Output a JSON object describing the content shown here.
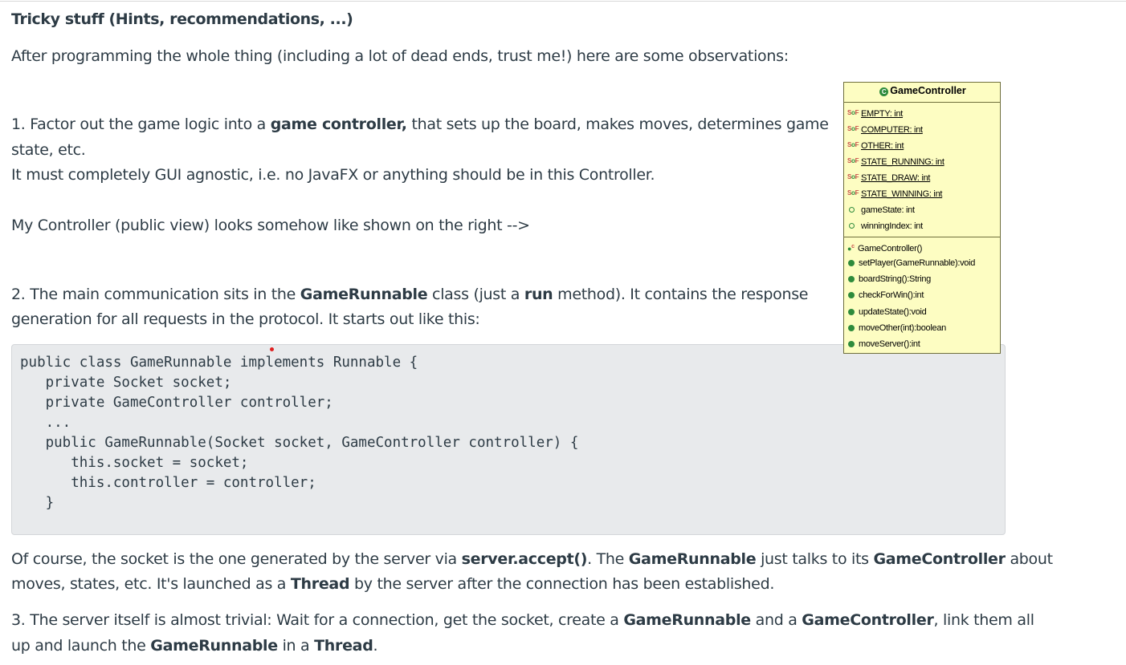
{
  "heading": "Tricky stuff (Hints, recommendations, ...)",
  "intro": "After programming the whole thing (including a lot of dead ends, trust me!) here are some observations:",
  "item1": {
    "a": "1. Factor out the game logic into a ",
    "b": "game controller,",
    "c": " that sets up the board, makes moves, determines game",
    "line2": "state, etc.",
    "line3": "It must completely GUI agnostic, i.e. no JavaFX or anything should be in this Controller.",
    "line4": "My Controller (public view) looks somehow like shown on the right -->"
  },
  "item2": {
    "a": "2. The main communication sits in the ",
    "b": "GameRunnable",
    "c": " class (just a ",
    "d": "run",
    "e": " method). It contains the response",
    "line2": "generation for all requests in the protocol.  It starts out like this:"
  },
  "code_lines": [
    "public class GameRunnable implements Runnable {",
    "   private Socket socket;",
    "   private GameController controller;",
    "   ...",
    "   public GameRunnable(Socket socket, GameController controller) {",
    "      this.socket = socket;",
    "      this.controller = controller;",
    "   }"
  ],
  "para_course": {
    "a": "Of course, the socket is the one generated by the server via ",
    "b": "server.accept()",
    "c": ". The ",
    "d": "GameRunnable",
    "e": " just talks to its ",
    "f": "GameController",
    "g": " about",
    "line2a": "moves, states, etc. It's launched as a ",
    "line2b": "Thread",
    "line2c": " by the server after the connection has been established."
  },
  "item3": {
    "a": "3. The server itself is almost trivial: Wait for a connection, get the socket, create a ",
    "b": "GameRunnable",
    "c": " and a ",
    "d": "GameController",
    "e": ", link them all",
    "line2a": "up and launch the ",
    "line2b": "GameRunnable",
    "line2c": " in a ",
    "line2d": "Thread",
    "line2e": "."
  },
  "uml": {
    "class_name": "GameController",
    "static_fields": [
      "EMPTY: int",
      "COMPUTER: int",
      "OTHER: int",
      "STATE_RUNNING: int",
      "STATE_DRAW: int",
      "STATE_WINNING: int"
    ],
    "fields": [
      "gameState: int",
      "winningIndex: int"
    ],
    "constructor": "GameController()",
    "methods": [
      "setPlayer(GameRunnable):void",
      "boardString():String",
      "checkForWin():int",
      "updateState():void",
      "moveOther(int):boolean",
      "moveServer():int"
    ]
  },
  "colors": {
    "text": "#2d3b45",
    "code_bg": "#e8eaec",
    "uml_bg": "#fdfdc2",
    "icon_green": "#2e8b3c"
  }
}
